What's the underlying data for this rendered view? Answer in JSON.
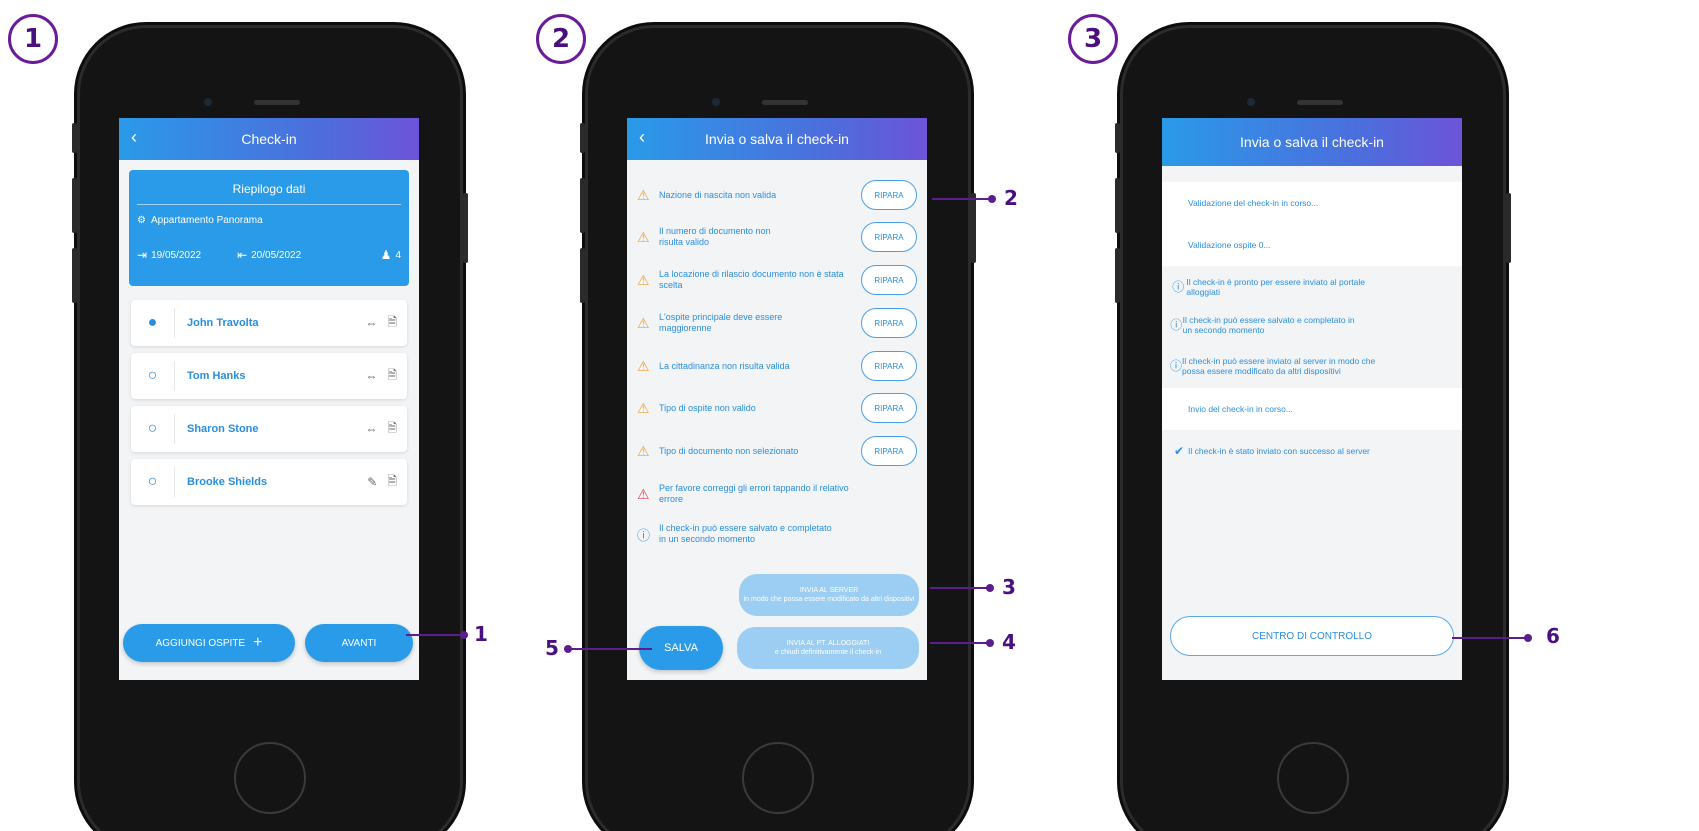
{
  "steps": [
    "1",
    "2",
    "3"
  ],
  "screen1": {
    "title": "Check-in",
    "summary_title": "Riepilogo dati",
    "apartment": "Appartamento Panorama",
    "checkin_date": "19/05/2022",
    "checkout_date": "20/05/2022",
    "guest_count": "4",
    "guests": [
      {
        "name": "John Travolta",
        "avatar": "user-filled-icon",
        "action": "link-icon"
      },
      {
        "name": "Tom Hanks",
        "avatar": "user-outline-icon",
        "action": "link-icon"
      },
      {
        "name": "Sharon Stone",
        "avatar": "user-outline-icon",
        "action": "link-icon"
      },
      {
        "name": "Brooke Shields",
        "avatar": "user-outline-icon",
        "action": "edit-icon"
      }
    ],
    "add_guest_label": "AGGIUNGI OSPITE",
    "next_label": "AVANTI"
  },
  "screen2": {
    "title": "Invia o salva il check-in",
    "errors": [
      {
        "text": "Nazione di nascita non valida",
        "button": "RIPARA"
      },
      {
        "text": "Il numero di documento non risulta valido",
        "button": "RIPARA"
      },
      {
        "text": "La locazione di rilascio documento non è stata scelta",
        "button": "RIPARA"
      },
      {
        "text": "L'ospite principale deve essere maggiorenne",
        "button": "RIPARA"
      },
      {
        "text": "La cittadinanza non risulta valida",
        "button": "RIPARA"
      },
      {
        "text": "Tipo di ospite non valido",
        "button": "RIPARA"
      },
      {
        "text": "Tipo di documento non selezionato",
        "button": "RIPARA"
      }
    ],
    "fix_errors_msg": "Per favore correggi gli errori tappando il relativo errore",
    "save_later_msg": "Il check-in può essere salvato e completato in un secondo momento",
    "send_server_title": "INVIA AL SERVER",
    "send_server_sub": "in modo che possa essere modificato da altri dispositivi",
    "save_label": "SALVA",
    "send_portal_title": "INVIA AL PT. ALLOGGIATI",
    "send_portal_sub": "e chiudi definitivamente il check-in"
  },
  "screen3": {
    "title": "Invia o salva il check-in",
    "rows": [
      {
        "text": "Validazione del check-in in corso...",
        "icon": ""
      },
      {
        "text": "Validazione ospite 0...",
        "icon": ""
      },
      {
        "text": "Il check-in è pronto per essere inviato al portale alloggiati",
        "icon": "info-icon"
      },
      {
        "text": "Il check-in può essere salvato e completato in un secondo momento",
        "icon": "info-icon"
      },
      {
        "text": "Il check-in può essere inviato al server in modo che possa essere modificato da altri dispositivi",
        "icon": "info-icon"
      },
      {
        "text": "Invio del check-in in corso...",
        "icon": ""
      },
      {
        "text": "Il check-in è stato inviato con successo al server",
        "icon": "check-circle-icon"
      }
    ],
    "control_center_label": "CENTRO DI CONTROLLO"
  },
  "callouts": [
    "1",
    "2",
    "3",
    "4",
    "5",
    "6"
  ],
  "colors": {
    "accent": "#2a9be8",
    "callout": "#5b1e8c",
    "warning": "#f0a030",
    "danger": "#e0405a"
  }
}
